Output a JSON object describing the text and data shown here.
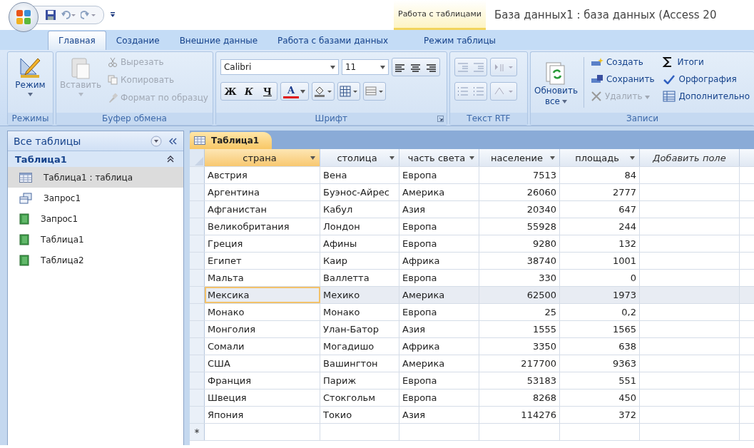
{
  "title_bar": {
    "context_group": "Работа с таблицами",
    "title": "База данных1 : база данных (Access 20"
  },
  "tabs": [
    {
      "label": "Главная",
      "selected": true,
      "kind": "normal"
    },
    {
      "label": "Создание",
      "selected": false,
      "kind": "normal"
    },
    {
      "label": "Внешние данные",
      "selected": false,
      "kind": "normal"
    },
    {
      "label": "Работа с базами данных",
      "selected": false,
      "kind": "normal"
    },
    {
      "label": "Режим таблицы",
      "selected": false,
      "kind": "context"
    }
  ],
  "ribbon": {
    "modes": {
      "label": "Режимы",
      "button": {
        "label": "Режим",
        "disabled": false
      }
    },
    "clipboard": {
      "label": "Буфер обмена",
      "paste": {
        "label": "Вставить",
        "disabled": true
      },
      "items": [
        {
          "label": "Вырезать",
          "kind": "cut",
          "disabled": true
        },
        {
          "label": "Копировать",
          "kind": "copy",
          "disabled": true
        },
        {
          "label": "Формат по образцу",
          "kind": "brush",
          "disabled": true
        }
      ]
    },
    "font": {
      "label": "Шрифт",
      "font_name": "Calibri",
      "font_size": "11",
      "styles": [
        {
          "label": "Ж",
          "kind": "bold"
        },
        {
          "label": "К",
          "kind": "italic"
        },
        {
          "label": "Ч",
          "kind": "underline"
        }
      ],
      "color_letter": "A"
    },
    "rtf": {
      "label": "Текст RTF"
    },
    "records": {
      "label": "Записи",
      "refresh": {
        "label": "Обновить",
        "sublabel": "все"
      },
      "items": [
        {
          "label": "Создать",
          "kind": "new",
          "disabled": false
        },
        {
          "label": "Сохранить",
          "kind": "save",
          "disabled": false
        },
        {
          "label": "Удалить",
          "kind": "delete",
          "disabled": true
        },
        {
          "label": "Итоги",
          "kind": "sum",
          "disabled": false
        },
        {
          "label": "Орфография",
          "kind": "spelling",
          "disabled": false
        },
        {
          "label": "Дополнительно",
          "kind": "more",
          "disabled": false
        }
      ]
    }
  },
  "nav": {
    "title": "Все таблицы",
    "groups": [
      {
        "label": "Таблица1",
        "expanded": true,
        "items": [
          {
            "label": "Таблица1 : таблица",
            "kind": "table",
            "selected": true
          },
          {
            "label": "Запрос1",
            "kind": "query",
            "selected": false
          },
          {
            "label": "Запрос1",
            "kind": "form",
            "selected": false
          },
          {
            "label": "Таблица1",
            "kind": "form",
            "selected": false
          },
          {
            "label": "Таблица2",
            "kind": "form",
            "selected": false
          }
        ]
      }
    ]
  },
  "datasheet": {
    "tab": "Таблица1",
    "new_row_marker": "*",
    "columns": [
      {
        "label": "страна",
        "kind": "text",
        "selected": true
      },
      {
        "label": "столица",
        "kind": "text",
        "selected": false
      },
      {
        "label": "часть света",
        "kind": "text",
        "selected": false
      },
      {
        "label": "население",
        "kind": "number",
        "selected": false
      },
      {
        "label": "площадь",
        "kind": "number",
        "selected": false
      },
      {
        "label": "Добавить поле",
        "kind": "add",
        "selected": false
      }
    ],
    "rows": [
      {
        "cells": [
          "Австрия",
          "Вена",
          "Европа",
          "7513",
          "84"
        ],
        "selected": false
      },
      {
        "cells": [
          "Аргентина",
          "Буэнос-Айрес",
          "Америка",
          "26060",
          "2777"
        ],
        "selected": false
      },
      {
        "cells": [
          "Афганистан",
          "Кабул",
          "Азия",
          "20340",
          "647"
        ],
        "selected": false
      },
      {
        "cells": [
          "Великобритания",
          "Лондон",
          "Европа",
          "55928",
          "244"
        ],
        "selected": false
      },
      {
        "cells": [
          "Греция",
          "Афины",
          "Европа",
          "9280",
          "132"
        ],
        "selected": false
      },
      {
        "cells": [
          "Египет",
          "Каир",
          "Африка",
          "38740",
          "1001"
        ],
        "selected": false
      },
      {
        "cells": [
          "Мальта",
          "Валлетта",
          "Европа",
          "330",
          "0"
        ],
        "selected": false
      },
      {
        "cells": [
          "Мексика",
          "Мехико",
          "Америка",
          "62500",
          "1973"
        ],
        "selected": true
      },
      {
        "cells": [
          "Монако",
          "Монако",
          "Европа",
          "25",
          "0,2"
        ],
        "selected": false
      },
      {
        "cells": [
          "Монголия",
          "Улан-Батор",
          "Азия",
          "1555",
          "1565"
        ],
        "selected": false
      },
      {
        "cells": [
          "Сомали",
          "Могадишо",
          "Африка",
          "3350",
          "638"
        ],
        "selected": false
      },
      {
        "cells": [
          "США",
          "Вашингтон",
          "Америка",
          "217700",
          "9363"
        ],
        "selected": false
      },
      {
        "cells": [
          "Франция",
          "Париж",
          "Европа",
          "53183",
          "551"
        ],
        "selected": false
      },
      {
        "cells": [
          "Швеция",
          "Стокгольм",
          "Европа",
          "8268",
          "450"
        ],
        "selected": false
      },
      {
        "cells": [
          "Япония",
          "Токио",
          "Азия",
          "114276",
          "372"
        ],
        "selected": false
      }
    ]
  }
}
